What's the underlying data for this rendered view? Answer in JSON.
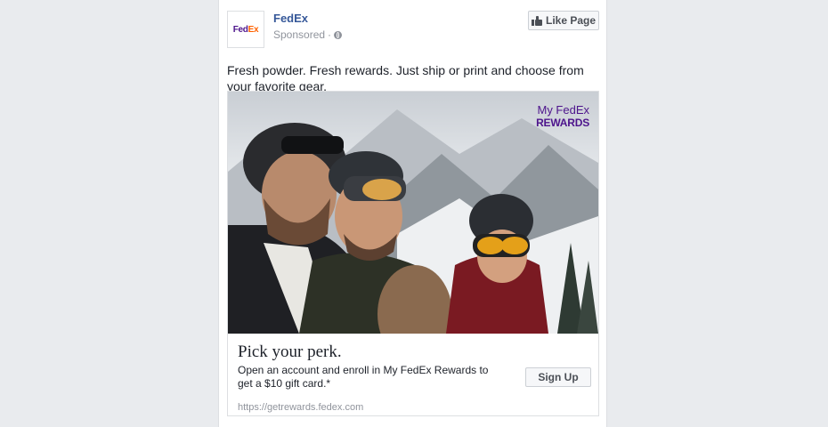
{
  "post": {
    "page_name": "FedEx",
    "sponsored_label": "Sponsored",
    "separator": "·",
    "like_button_label": "Like Page",
    "logo": {
      "fed": "Fed",
      "ex": "Ex"
    },
    "text": "Fresh powder. Fresh rewards. Just ship or print and choose from your favorite gear."
  },
  "ad": {
    "image_overlay": {
      "line1": "My FedEx",
      "line2": "REWARDS"
    },
    "headline": "Pick your perk.",
    "description": "Open an account and enroll in My FedEx Rewards to get a $10 gift card.*",
    "cta_label": "Sign Up",
    "url": "https://getrewards.fedex.com"
  },
  "colors": {
    "link_blue": "#365899",
    "fedex_purple": "#4d148c",
    "fedex_orange": "#ff6200",
    "page_bg": "#e9ebee"
  },
  "icons": [
    "globe-icon",
    "thumbs-up-icon"
  ]
}
